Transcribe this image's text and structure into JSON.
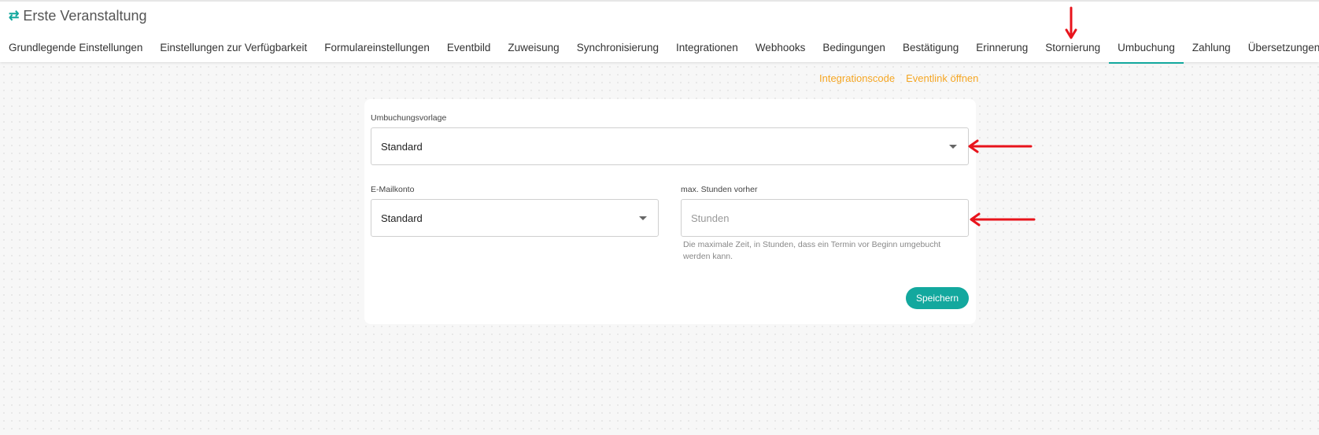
{
  "header": {
    "title": "Erste Veranstaltung",
    "title_icon": "swap-icon",
    "tabs": [
      {
        "label": "Grundlegende Einstellungen"
      },
      {
        "label": "Einstellungen zur Verfügbarkeit"
      },
      {
        "label": "Formulareinstellungen"
      },
      {
        "label": "Eventbild"
      },
      {
        "label": "Zuweisung"
      },
      {
        "label": "Synchronisierung"
      },
      {
        "label": "Integrationen"
      },
      {
        "label": "Webhooks"
      },
      {
        "label": "Bedingungen"
      },
      {
        "label": "Bestätigung"
      },
      {
        "label": "Erinnerung"
      },
      {
        "label": "Stornierung"
      },
      {
        "label": "Umbuchung"
      },
      {
        "label": "Zahlung"
      },
      {
        "label": "Übersetzungen"
      }
    ],
    "active_tab": "Umbuchung"
  },
  "links": {
    "integration_code": "Integrationscode",
    "open_event_link": "Eventlink öffnen"
  },
  "form": {
    "template_label": "Umbuchungsvorlage",
    "template_value": "Standard",
    "email_label": "E-Mailkonto",
    "email_value": "Standard",
    "hours_label": "max. Stunden vorher",
    "hours_placeholder": "Stunden",
    "hours_hint": "Die maximale Zeit, in Stunden, dass ein Termin vor Beginn umgebucht werden kann.",
    "save_label": "Speichern"
  },
  "colors": {
    "accent": "#13a89e",
    "link": "#f5a623",
    "annotation_arrow": "#e8141c"
  }
}
